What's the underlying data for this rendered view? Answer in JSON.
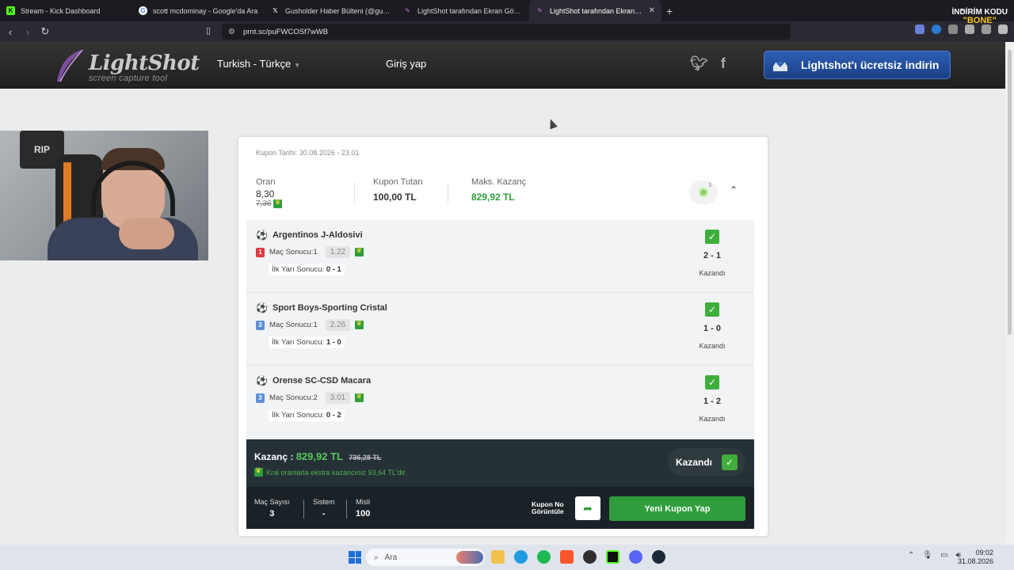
{
  "browser": {
    "tabs": [
      {
        "title": "Stream - Kick Dashboard",
        "icon": "kick-icon",
        "color": "#53fc18",
        "active": false
      },
      {
        "title": "scott mcdominay - Google'da Ara",
        "icon": "google-icon",
        "color": "#ffffff",
        "active": false
      },
      {
        "title": "Gusholder Haber Bülteni (@gusholde",
        "icon": "x-icon",
        "color": "#ffffff",
        "active": false
      },
      {
        "title": "LightShot tarafından Ekran Görüntüs",
        "icon": "lightshot-icon",
        "color": "#9b59b6",
        "active": false
      },
      {
        "title": "LightShot tarafından Ekran Görü",
        "icon": "lightshot-icon",
        "color": "#9b59b6",
        "active": true
      }
    ],
    "new_tab": "+",
    "url": "prnt.sc/puFWCOSf7wWB",
    "promo_line1": "İNDİRİM KODU",
    "promo_line2": "\"BONE\""
  },
  "header": {
    "logo_name": "LightShot",
    "logo_tagline": "screen capture tool",
    "language": "Turkish - Türkçe",
    "login": "Giriş yap",
    "download": "Lightshot'ı ücretsiz indirin"
  },
  "coupon": {
    "date": "Kupon Tarihi: 30.08.2026 - 23.01",
    "oran_label": "Oran",
    "oran_value": "8,30",
    "oran_old": "7,36",
    "tutar_label": "Kupon Tutarı",
    "tutar_value": "100,00 TL",
    "maks_label": "Maks. Kazanç",
    "maks_value": "829,92 TL",
    "badge_count": "3",
    "matches": [
      {
        "teams": "Argentinos J-Aldosivi",
        "num": "1",
        "num_color": "#e0383e",
        "market": "Maç Sonucu:1",
        "odd": "1.22",
        "ht_label": "İlk Yarı Sonucu:",
        "ht_value": "0 - 1",
        "score": "2 - 1",
        "status": "Kazandı"
      },
      {
        "teams": "Sport Boys-Sporting Cristal",
        "num": "3",
        "num_color": "#5b8fd6",
        "market": "Maç Sonucu:1",
        "odd": "2.26",
        "ht_label": "İlk Yarı Sonucu:",
        "ht_value": "1 - 0",
        "score": "1 - 0",
        "status": "Kazandı"
      },
      {
        "teams": "Orense SC-CSD Macara",
        "num": "3",
        "num_color": "#5b8fd6",
        "market": "Maç Sonucu:2",
        "odd": "3.01",
        "ht_label": "İlk Yarı Sonucu:",
        "ht_value": "0 - 2",
        "score": "1 - 2",
        "status": "Kazandı"
      }
    ],
    "win_label": "Kazanç :",
    "win_amount": "829,92 TL",
    "win_old": "736,28 TL",
    "win_extra": "Kral oranlarla ekstra kazancınız 93,64 TL'dir.",
    "win_status": "Kazandı",
    "mac_sayisi_label": "Maç Sayısı",
    "mac_sayisi": "3",
    "sistem_label": "Sistem",
    "sistem": "-",
    "misli_label": "Misli",
    "misli": "100",
    "kupon_no_line1": "Kupon No",
    "kupon_no_line2": "Görüntüle",
    "new_coupon": "Yeni Kupon Yap"
  },
  "webcam": {
    "poster_text": "RIP"
  },
  "taskbar": {
    "search_placeholder": "Ara",
    "time": "09:02",
    "date": "31.08.2026"
  }
}
